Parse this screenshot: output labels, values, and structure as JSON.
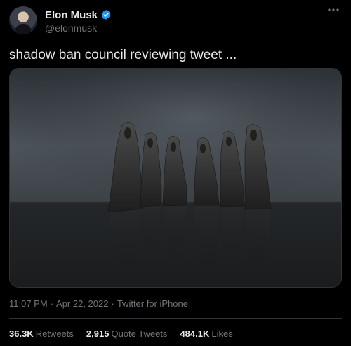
{
  "author": {
    "name": "Elon Musk",
    "handle": "@elonmusk",
    "verified": true
  },
  "more_icon": "ellipsis-icon",
  "tweet": {
    "text": "shadow ban council reviewing tweet ..."
  },
  "meta": {
    "time": "11:07 PM",
    "sep1": "·",
    "date": "Apr 22, 2022",
    "sep2": "·",
    "source": "Twitter for iPhone"
  },
  "stats": {
    "retweets_count": "36.3K",
    "retweets_label": "Retweets",
    "quotes_count": "2,915",
    "quotes_label": "Quote Tweets",
    "likes_count": "484.1K",
    "likes_label": "Likes"
  },
  "colors": {
    "background": "#000000",
    "text_primary": "#e7e9ea",
    "text_secondary": "#71767b",
    "verified_blue": "#1d9bf0",
    "border": "#2f3336"
  }
}
